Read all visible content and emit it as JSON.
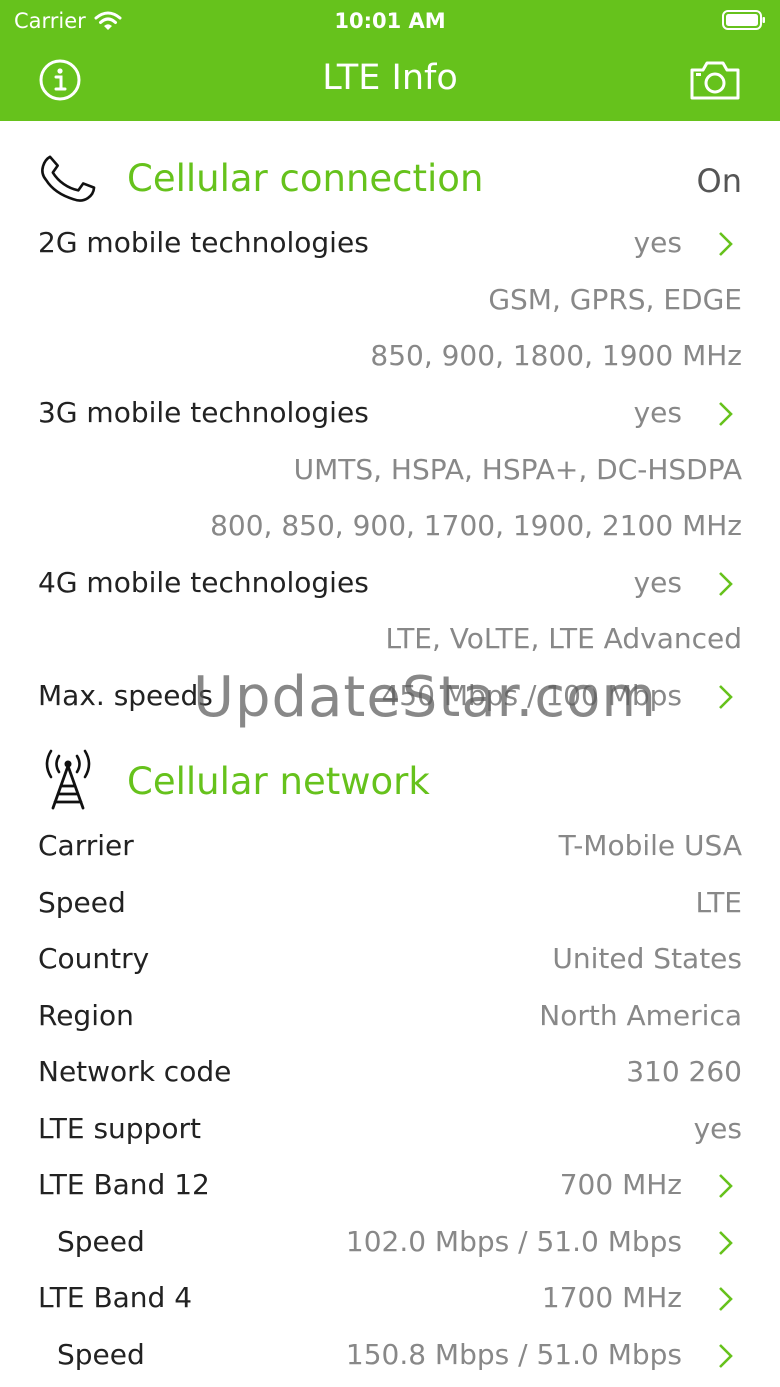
{
  "status_bar": {
    "carrier": "Carrier",
    "time": "10:01 AM"
  },
  "nav": {
    "title": "LTE Info"
  },
  "colors": {
    "accent": "#66c21c",
    "value_text": "#888888",
    "label_text": "#222222"
  },
  "cellular_connection": {
    "title": "Cellular connection",
    "status": "On",
    "tech_2g": {
      "label": "2G mobile technologies",
      "value": "yes",
      "line1": "GSM, GPRS, EDGE",
      "line2": "850, 900, 1800, 1900 MHz"
    },
    "tech_3g": {
      "label": "3G mobile technologies",
      "value": "yes",
      "line1": "UMTS, HSPA, HSPA+, DC-HSDPA",
      "line2": "800, 850, 900, 1700, 1900, 2100 MHz"
    },
    "tech_4g": {
      "label": "4G mobile technologies",
      "value": "yes",
      "line1": "LTE, VoLTE, LTE Advanced"
    },
    "max_speeds": {
      "label": "Max. speeds",
      "value": "450 Mbps / 100 Mbps"
    }
  },
  "cellular_network": {
    "title": "Cellular network",
    "carrier": {
      "label": "Carrier",
      "value": "T-Mobile USA"
    },
    "speed": {
      "label": "Speed",
      "value": "LTE"
    },
    "country": {
      "label": "Country",
      "value": "United States"
    },
    "region": {
      "label": "Region",
      "value": "North America"
    },
    "network_code": {
      "label": "Network code",
      "value": "310 260"
    },
    "lte_support": {
      "label": "LTE support",
      "value": "yes"
    },
    "band12": {
      "label": "LTE Band 12",
      "value": "700 MHz"
    },
    "band12_speed": {
      "label": "Speed",
      "value": "102.0 Mbps / 51.0 Mbps"
    },
    "band4": {
      "label": "LTE Band 4",
      "value": "1700 MHz"
    },
    "band4_speed": {
      "label": "Speed",
      "value": "150.8 Mbps / 51.0 Mbps"
    }
  },
  "watermark": "UpdateStar.com"
}
